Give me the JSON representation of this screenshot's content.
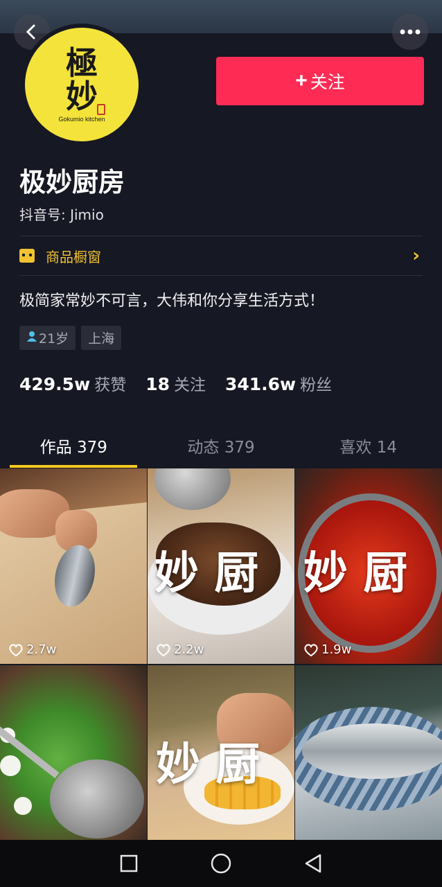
{
  "header": {
    "back_icon": "chevron-left-icon",
    "more_icon": "more-horizontal-icon"
  },
  "profile": {
    "avatar": {
      "logo_text_top": "極",
      "logo_text_bottom": "妙",
      "logo_caption": "Gokumio kitchen"
    },
    "follow_label": "关注",
    "name": "极妙厨房",
    "douyin_id": "抖音号: Jimio",
    "shop_label": "商品橱窗",
    "bio": "极简家常妙不可言，大伟和你分享生活方式！",
    "tags": {
      "age": "21岁",
      "location": "上海"
    },
    "stats": {
      "likes_value": "429.5w",
      "likes_label": "获赞",
      "following_value": "18",
      "following_label": "关注",
      "fans_value": "341.6w",
      "fans_label": "粉丝"
    }
  },
  "tabs": [
    "作品 379",
    "动态 379",
    "喜欢 14"
  ],
  "active_tab": 0,
  "videos": [
    {
      "likes": "2.7w",
      "overlay": ""
    },
    {
      "likes": "2.2w",
      "overlay": "妙 厨"
    },
    {
      "likes": "1.9w",
      "overlay": "妙 厨"
    },
    {
      "likes": "",
      "overlay": ""
    },
    {
      "likes": "",
      "overlay": "妙 厨"
    },
    {
      "likes": "",
      "overlay": ""
    }
  ],
  "colors": {
    "background": "#161823",
    "follow_button": "#fe2c55",
    "accent_yellow": "#f1c232",
    "tab_underline": "#f7c91d",
    "avatar_bg": "#f4e33a"
  },
  "navbar": {
    "icons": [
      "square-recents-icon",
      "circle-home-icon",
      "triangle-back-icon"
    ]
  }
}
